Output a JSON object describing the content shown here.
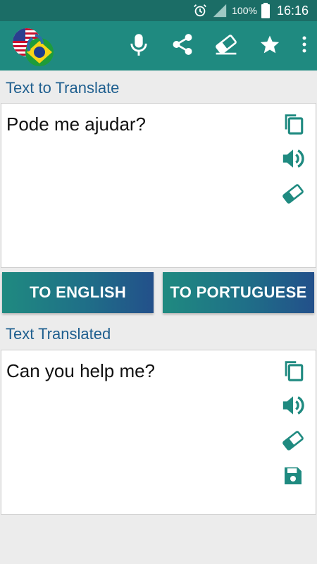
{
  "status_bar": {
    "battery": "100%",
    "time": "16:16"
  },
  "colors": {
    "primary": "#1f8a80",
    "status_bar": "#1b6d66",
    "label": "#1f5f8f",
    "icon": "#1f8a80"
  },
  "toolbar": {
    "logo": "us-brazil-flags-logo",
    "actions": [
      "microphone-icon",
      "share-icon",
      "eraser-icon",
      "star-icon",
      "more-vert-icon"
    ]
  },
  "source": {
    "label": "Text to Translate",
    "text": "Pode me ajudar?",
    "icons": [
      "copy-icon",
      "speaker-icon",
      "eraser-icon"
    ]
  },
  "buttons": {
    "to_english": "TO ENGLISH",
    "to_portuguese": "TO PORTUGUESE"
  },
  "result": {
    "label": "Text Translated",
    "text": "Can you help me?",
    "icons": [
      "copy-icon",
      "speaker-icon",
      "eraser-icon",
      "save-icon"
    ]
  }
}
